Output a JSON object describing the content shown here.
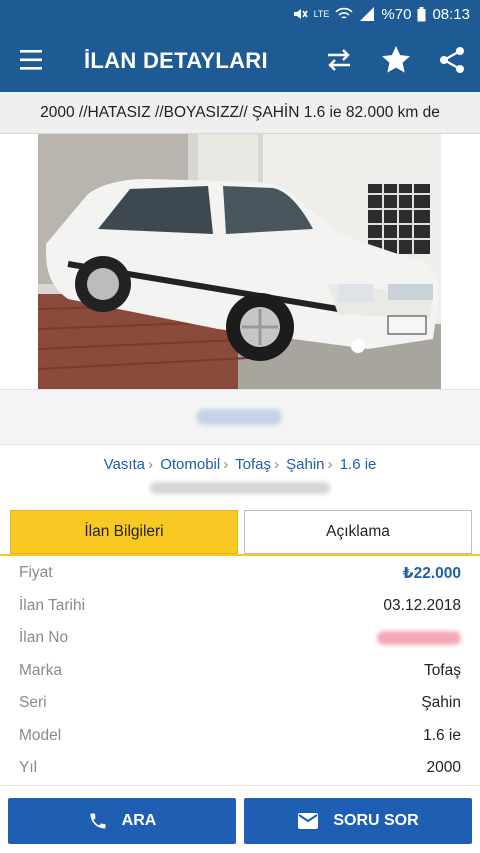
{
  "status_bar": {
    "battery": "%70",
    "time": "08:13",
    "network": "LTE"
  },
  "app_bar": {
    "title": "İLAN DETAYLARI",
    "menu_icon": "hamburger-menu-icon",
    "compare_icon": "swap-arrows-icon",
    "favorite_icon": "star-icon",
    "share_icon": "share-icon"
  },
  "listing": {
    "headline": "2000 //HATASIZ //BOYASIZZ// ŞAHİN 1.6 ie 82.000 km de"
  },
  "breadcrumb": [
    "Vasıta",
    "Otomobil",
    "Tofaş",
    "Şahin",
    "1.6 ie"
  ],
  "tabs": {
    "info": "İlan Bilgileri",
    "description": "Açıklama"
  },
  "details": [
    {
      "label": "Fiyat",
      "value": "₺22.000"
    },
    {
      "label": "İlan Tarihi",
      "value": "03.12.2018"
    },
    {
      "label": "İlan No",
      "value": ""
    },
    {
      "label": "Marka",
      "value": "Tofaş"
    },
    {
      "label": "Seri",
      "value": "Şahin"
    },
    {
      "label": "Model",
      "value": "1.6 ie"
    },
    {
      "label": "Yıl",
      "value": "2000"
    }
  ],
  "actions": {
    "call": "ARA",
    "ask": "SORU SOR"
  },
  "colors": {
    "primary": "#1e5a94",
    "accent": "#f9c923",
    "link": "#1e5fa8"
  }
}
